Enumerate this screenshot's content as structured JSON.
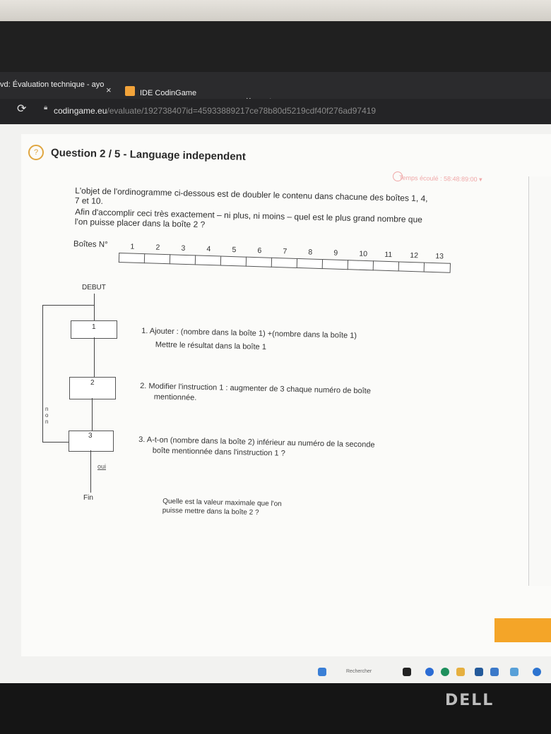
{
  "browser": {
    "tabs": [
      {
        "label": "vd: Évaluation technique - ayo",
        "close": "×"
      },
      {
        "label": "IDE CodinGame",
        "close": "×"
      }
    ],
    "new_tab": "+",
    "url_domain": "codingame.eu",
    "url_path": "/evaluate/192738407id=45933889217ce78b80d5219cdf40f276ad97419"
  },
  "question": {
    "icon": "?",
    "title": "Question 2 / 5 - Language independent",
    "timer": "Temps écoulé : 58:48:89:00 ▾",
    "intro_line1": "L'objet de l'ordinogramme ci-dessous est de doubler le contenu dans chacune des boîtes 1, 4,",
    "intro_line2": "7 et 10.",
    "intro_line3": "Afin d'accomplir ceci très exactement – ni plus, ni moins – quel est le plus grand nombre que",
    "intro_line4": "l'on puisse placer dans la boîte 2 ?",
    "boxes_label": "Boîtes N°",
    "box_numbers": [
      "1",
      "2",
      "3",
      "4",
      "5",
      "6",
      "7",
      "8",
      "9",
      "10",
      "11",
      "12",
      "13"
    ]
  },
  "flowchart": {
    "start": "DEBUT",
    "step1": "1",
    "step2": "2",
    "step3": "3",
    "oui": "oui",
    "non": "n\no\nn",
    "end": "Fin"
  },
  "instructions": {
    "i1_line1": "1.  Ajouter : (nombre dans la boîte 1) +(nombre dans la boîte 1)",
    "i1_line2": "Mettre le résultat dans la boîte 1",
    "i2_line1": "2.  Modifier l'instruction 1 : augmenter de 3 chaque numéro de boîte",
    "i2_line2": "mentionnée.",
    "i3_line1": "3.  A-t-on (nombre dans la boîte 2) inférieur au numéro de la seconde",
    "i3_line2": "boîte mentionnée dans l'instruction 1 ?",
    "final_q_line1": "Quelle est la valeur maximale que l'on",
    "final_q_line2": "puisse mettre dans la boîte 2 ?"
  },
  "taskbar": {
    "search": "Rechercher"
  },
  "hardware": {
    "brand": "DELL"
  }
}
